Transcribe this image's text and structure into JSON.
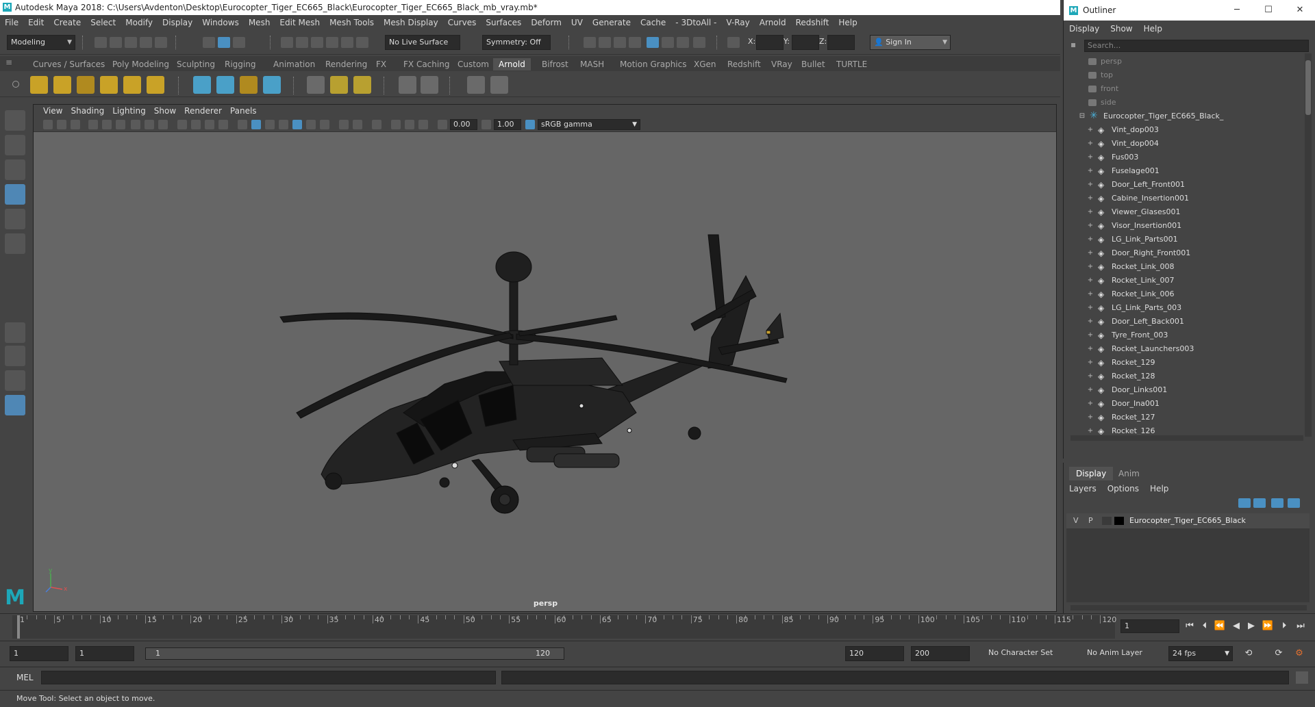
{
  "title_bar": {
    "text": "Autodesk Maya 2018: C:\\Users\\Avdenton\\Desktop\\Eurocopter_Tiger_EC665_Black\\Eurocopter_Tiger_EC665_Black_mb_vray.mb*",
    "logo": "M"
  },
  "menu": [
    "File",
    "Edit",
    "Create",
    "Select",
    "Modify",
    "Display",
    "Windows",
    "Mesh",
    "Edit Mesh",
    "Mesh Tools",
    "Mesh Display",
    "Curves",
    "Surfaces",
    "Deform",
    "UV",
    "Generate",
    "Cache",
    "- 3DtoAll -",
    "V-Ray",
    "Arnold",
    "Redshift",
    "Help"
  ],
  "status_line": {
    "mode": "Modeling",
    "live_surface": "No Live Surface",
    "symmetry": "Symmetry: Off",
    "x_label": "X:",
    "y_label": "Y:",
    "z_label": "Z:",
    "sign_in": "Sign In"
  },
  "shelf_tabs": [
    "Curves / Surfaces",
    "Poly Modeling",
    "Sculpting",
    "Rigging",
    "Animation",
    "Rendering",
    "FX",
    "FX Caching",
    "Custom",
    "Arnold",
    "Bifrost",
    "MASH",
    "Motion Graphics",
    "XGen",
    "Redshift",
    "VRay",
    "Bullet",
    "TURTLE"
  ],
  "active_shelf_tab": "Arnold",
  "viewport": {
    "menu": [
      "View",
      "Shading",
      "Lighting",
      "Show",
      "Renderer",
      "Panels"
    ],
    "exposure": "0.00",
    "gamma": "1.00",
    "color_space": "sRGB gamma",
    "camera_label": "persp",
    "axis_y": "y",
    "axis_x": "x"
  },
  "outliner": {
    "title": "Outliner",
    "logo": "M",
    "menu": [
      "Display",
      "Show",
      "Help"
    ],
    "search_placeholder": "Search...",
    "cameras": [
      "persp",
      "top",
      "front",
      "side"
    ],
    "root": "Eurocopter_Tiger_EC665_Black_",
    "children": [
      "Vint_dop003",
      "Vint_dop004",
      "Fus003",
      "Fuselage001",
      "Door_Left_Front001",
      "Cabine_Insertion001",
      "Viewer_Glases001",
      "Visor_Insertion001",
      "LG_Link_Parts001",
      "Door_Right_Front001",
      "Rocket_Link_008",
      "Rocket_Link_007",
      "Rocket_Link_006",
      "LG_Link_Parts_003",
      "Door_Left_Back001",
      "Tyre_Front_003",
      "Rocket_Launchers003",
      "Rocket_129",
      "Rocket_128",
      "Door_Links001",
      "Door_Ina001",
      "Rocket_127",
      "Rocket_126"
    ]
  },
  "channel_box": {
    "tabs": [
      "Display",
      "Anim"
    ],
    "active_tab": "Display",
    "menu": [
      "Layers",
      "Options",
      "Help"
    ],
    "layer": {
      "v": "V",
      "p": "P",
      "name": "Eurocopter_Tiger_EC665_Black"
    }
  },
  "time_slider": {
    "labels": [
      "1",
      "5",
      "10",
      "15",
      "20",
      "25",
      "30",
      "35",
      "40",
      "45",
      "50",
      "55",
      "60",
      "65",
      "70",
      "75",
      "80",
      "85",
      "90",
      "95",
      "100",
      "105",
      "110",
      "115",
      "120"
    ],
    "current_frame": "1"
  },
  "range": {
    "start": "1",
    "playback_start": "1",
    "slider_start": "1",
    "slider_end": "120",
    "playback_end": "120",
    "end": "200",
    "character_set": "No Character Set",
    "anim_layer": "No Anim Layer",
    "fps": "24 fps"
  },
  "command_line": {
    "label": "MEL"
  },
  "help_line": "Move Tool: Select an object to move.",
  "colors": {
    "accent": "#4a90c2",
    "maya_teal": "#1da7b8",
    "viewport_bg": "#666666"
  }
}
